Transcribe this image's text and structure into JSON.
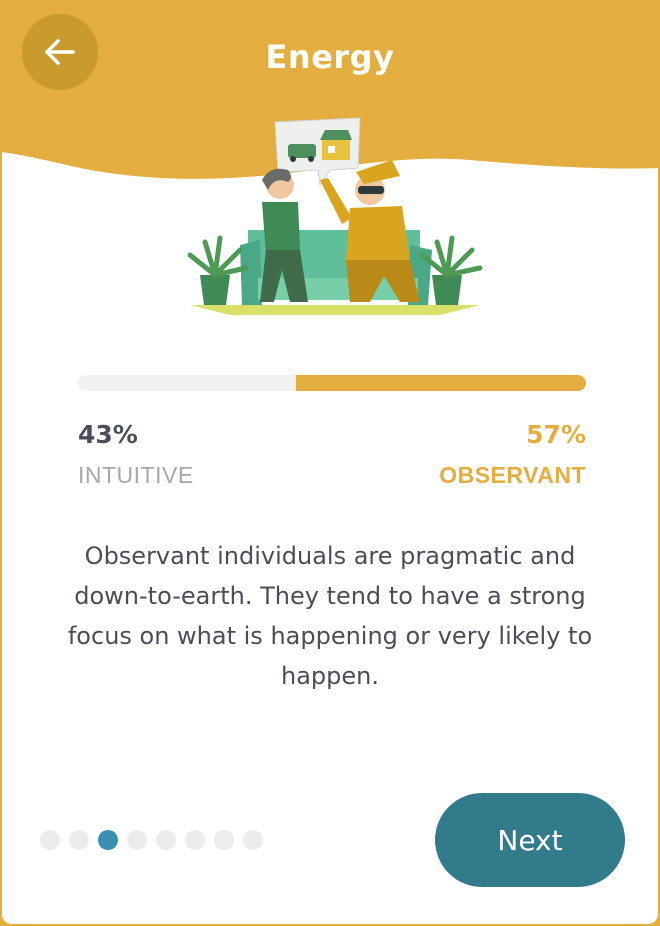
{
  "header": {
    "title": "Energy",
    "back_icon": "arrow-left-icon"
  },
  "illustration": {
    "icon": "couple-on-sofa-illustration"
  },
  "result": {
    "left_percent": "43%",
    "right_percent": "57%",
    "left_label": "INTUITIVE",
    "right_label": "OBSERVANT",
    "observant_fraction": 0.57
  },
  "description": "Observant individuals are pragmatic and down-to-earth. They tend to have a strong focus on what is happening or very likely to happen.",
  "pagination": {
    "total": 8,
    "current": 3
  },
  "footer": {
    "next_label": "Next"
  },
  "colors": {
    "accent": "#e3ad3f",
    "button": "#317b8b",
    "active_dot": "#3a8fb0"
  }
}
